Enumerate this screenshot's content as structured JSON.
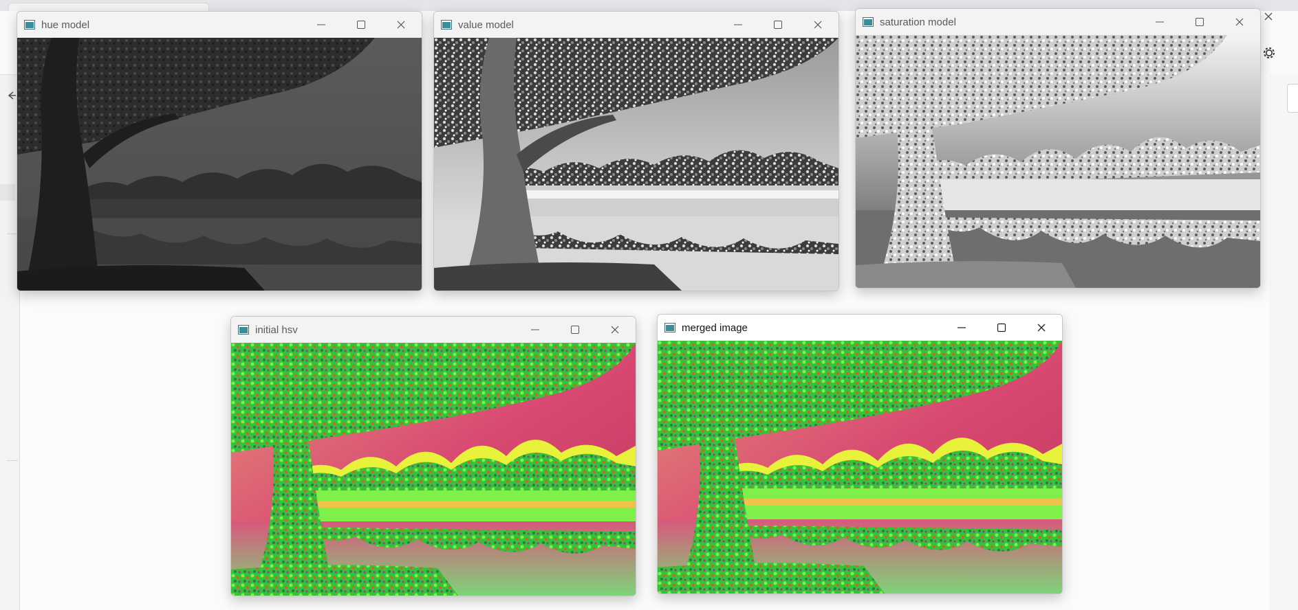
{
  "windows": {
    "hue": {
      "title": "hue model"
    },
    "value": {
      "title": "value model"
    },
    "saturation": {
      "title": "saturation model"
    },
    "initial_hsv": {
      "title": "initial hsv"
    },
    "merged": {
      "title": "merged image"
    }
  },
  "icons": {
    "minimize": "minimize-icon",
    "maximize": "maximize-icon",
    "close": "close-icon",
    "back": "arrow-left-icon",
    "settings": "gear-icon"
  },
  "colors": {
    "hsv_green": "#3fe23a",
    "hsv_magenta": "#d84a72",
    "hsv_yellow": "#e9f23a"
  }
}
